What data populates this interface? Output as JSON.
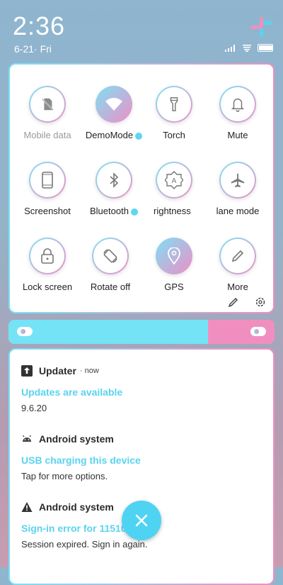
{
  "status_bar": {
    "time": "2:36",
    "date": "6-21· Fri",
    "battery_level": 1.0,
    "icons": [
      "signal-icon",
      "wifi-icon",
      "battery-icon"
    ]
  },
  "quick_settings": {
    "tiles": [
      {
        "label": "Mobile data",
        "icon": "sim-off-icon",
        "active": false,
        "dimmed": true
      },
      {
        "label": "DemoMode",
        "icon": "wifi-icon",
        "active": true,
        "dot": true
      },
      {
        "label": "Torch",
        "icon": "flashlight-icon",
        "active": false
      },
      {
        "label": "Mute",
        "icon": "bell-icon",
        "active": false
      },
      {
        "label": "Screenshot",
        "icon": "phone-icon",
        "active": false
      },
      {
        "label": "Bluetooth",
        "icon": "bluetooth-icon",
        "active": false,
        "dot": true
      },
      {
        "label": "Brightness",
        "icon": "brightness-auto-icon",
        "active": false
      },
      {
        "label": "Airplane mode",
        "icon": "airplane-icon",
        "active": false
      },
      {
        "label": "Lock screen",
        "icon": "lock-icon",
        "active": false
      },
      {
        "label": "Rotate off",
        "icon": "rotate-icon",
        "active": false
      },
      {
        "label": "GPS",
        "icon": "location-icon",
        "active": true
      },
      {
        "label": "More",
        "icon": "pencil-icon",
        "active": false
      }
    ],
    "visible_labels": {
      "brightness": "rightness",
      "airplane": "lane mode"
    }
  },
  "brightness_slider": {
    "level": 0.75
  },
  "notifications": [
    {
      "app": "Updater",
      "time": "now",
      "title": "Updates are available",
      "body": "9.6.20",
      "icon": "upload-icon"
    },
    {
      "app": "Android system",
      "title": "USB charging this device",
      "body": "Tap for more options.",
      "icon": "android-icon"
    },
    {
      "app": "Android system",
      "title": "Sign-in error for 11510",
      "body": "Session expired. Sign in again.",
      "icon": "warning-icon"
    }
  ],
  "colors": {
    "accent_cyan": "#5ad3ef",
    "accent_pink": "#f08fbf"
  }
}
